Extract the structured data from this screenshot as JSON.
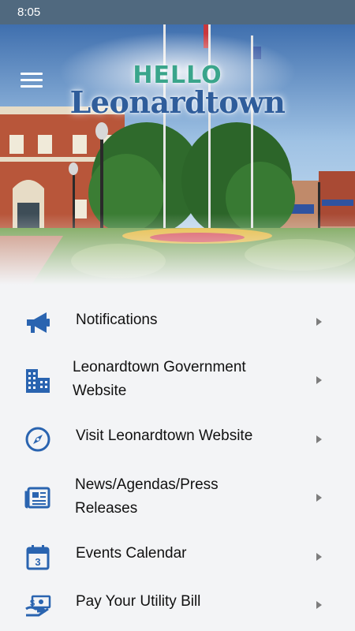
{
  "status_bar": {
    "time": "8:05"
  },
  "header": {
    "logo_hello": "HELLO",
    "logo_town": "Leonardtown"
  },
  "menu": {
    "items": [
      {
        "label": "Notifications",
        "icon": "megaphone-icon"
      },
      {
        "label": "Leonardtown Government Website",
        "icon": "building-icon"
      },
      {
        "label": "Visit Leonardtown Website",
        "icon": "compass-icon"
      },
      {
        "label": "News/Agendas/Press Releases",
        "icon": "newspaper-icon"
      },
      {
        "label": "Events Calendar",
        "icon": "calendar-icon"
      },
      {
        "label": "Pay Your Utility Bill",
        "icon": "bill-payment-icon"
      }
    ]
  },
  "colors": {
    "status_bar": "#50697f",
    "icon_blue": "#2a64b0",
    "background": "#f3f4f6"
  }
}
